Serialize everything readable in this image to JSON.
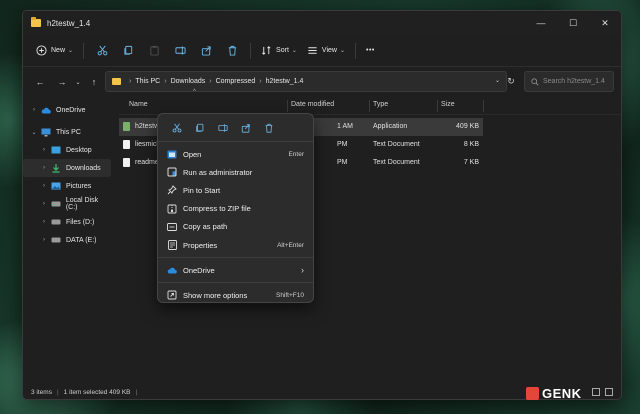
{
  "window": {
    "title": "h2testw_1.4",
    "controls": {
      "minimize": "—",
      "maximize": "☐",
      "close": "✕"
    }
  },
  "toolbar": {
    "new_label": "New",
    "sort_label": "Sort",
    "view_label": "View",
    "more_label": "•••"
  },
  "address": {
    "crumbs": [
      "This PC",
      "Downloads",
      "Compressed",
      "h2testw_1.4"
    ],
    "search_placeholder": "Search h2testw_1.4"
  },
  "sidebar": {
    "items": [
      {
        "label": "OneDrive",
        "icon": "cloud-icon"
      },
      {
        "label": "This PC",
        "icon": "monitor-icon"
      },
      {
        "label": "Desktop",
        "icon": "desktop-icon"
      },
      {
        "label": "Downloads",
        "icon": "download-icon"
      },
      {
        "label": "Pictures",
        "icon": "pictures-icon"
      },
      {
        "label": "Local Disk (C:)",
        "icon": "drive-icon"
      },
      {
        "label": "Files (D:)",
        "icon": "drive-icon"
      },
      {
        "label": "DATA (E:)",
        "icon": "drive-icon"
      }
    ]
  },
  "columns": {
    "name": "Name",
    "date": "Date modified",
    "type": "Type",
    "size": "Size"
  },
  "files": [
    {
      "name": "h2testw.",
      "date": "1 AM",
      "type": "Application",
      "size": "409 KB"
    },
    {
      "name": "liesmich",
      "date": "PM",
      "type": "Text Document",
      "size": "8 KB"
    },
    {
      "name": "readme.",
      "date": "PM",
      "type": "Text Document",
      "size": "7 KB"
    }
  ],
  "status": {
    "items": "3 items",
    "selected": "1 item selected  409 KB"
  },
  "context_menu": {
    "items": [
      {
        "label": "Open",
        "shortcut": "Enter"
      },
      {
        "label": "Run as administrator",
        "shortcut": ""
      },
      {
        "label": "Pin to Start",
        "shortcut": ""
      },
      {
        "label": "Compress to ZIP file",
        "shortcut": ""
      },
      {
        "label": "Copy as path",
        "shortcut": ""
      },
      {
        "label": "Properties",
        "shortcut": "Alt+Enter"
      }
    ],
    "onedrive": {
      "label": "OneDrive",
      "arrow": "›"
    },
    "more": {
      "label": "Show more options",
      "shortcut": "Shift+F10"
    }
  },
  "watermark": {
    "text": "GENK"
  },
  "colors": {
    "accent": "#60cdff",
    "folder": "#f4c54a",
    "watermark_red": "#e5463a"
  }
}
